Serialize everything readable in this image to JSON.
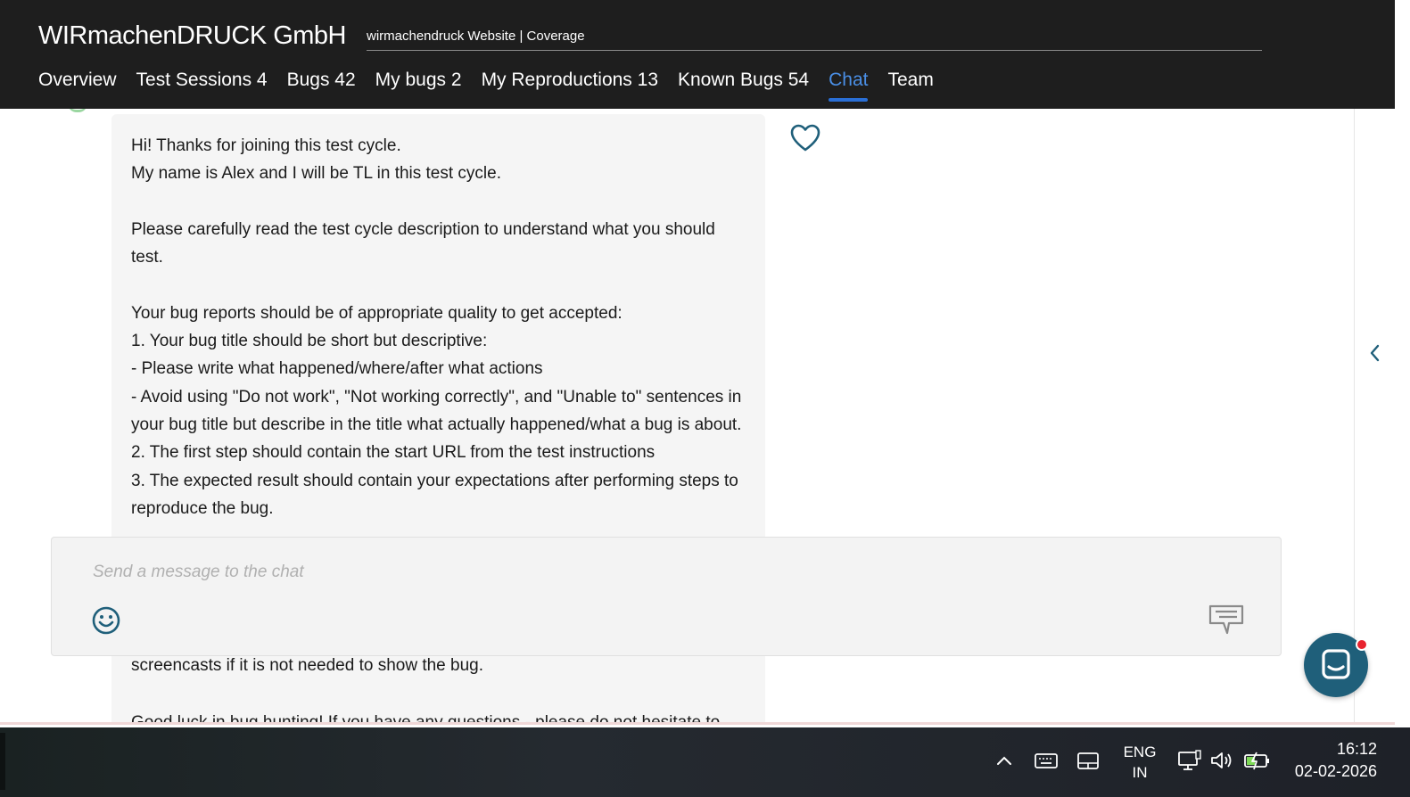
{
  "header": {
    "company": "WIRmachenDRUCK GmbH",
    "project": "wirmachendruck Website | Coverage"
  },
  "nav": {
    "items": [
      {
        "label": "Overview"
      },
      {
        "label": "Test Sessions 4"
      },
      {
        "label": "Bugs 42"
      },
      {
        "label": "My bugs 2"
      },
      {
        "label": "My Reproductions 13"
      },
      {
        "label": "Known Bugs 54"
      },
      {
        "label": "Chat",
        "active": true
      },
      {
        "label": "Team"
      }
    ]
  },
  "message": {
    "text": "Hi! Thanks for joining this test cycle.\nMy name is Alex and I will be TL in this test cycle.\n\nPlease carefully read the test cycle description to understand what you should test.\n\nYour bug reports should be of appropriate quality to get accepted:\n1. Your bug title should be short but descriptive:\n- Please write what happened/where/after what actions\n- Avoid using \"Do not work\", \"Not working correctly\", and \"Unable to\" sentences in your bug title but describe in the title what actually happened/what a bug is about.\n2. The first step should contain the start URL from the test instructions\n3. The expected result should contain your expectations after performing steps to reproduce the bug.",
    "text_below_composer": "screencasts if it is not needed to show the bug.",
    "text_cut_off": "Good luck in bug hunting! If you have any questions - please do not hesitate to"
  },
  "composer": {
    "placeholder": "Send a message to the chat"
  },
  "taskbar": {
    "lang_line1": "ENG",
    "lang_line2": "IN",
    "time": "16:12",
    "date": "02-02-2026"
  },
  "colors": {
    "header_bg": "#1e1e1e",
    "nav_active": "#4a8fe6",
    "accent_teal": "#1f5f7a",
    "notification": "#e8232f"
  }
}
